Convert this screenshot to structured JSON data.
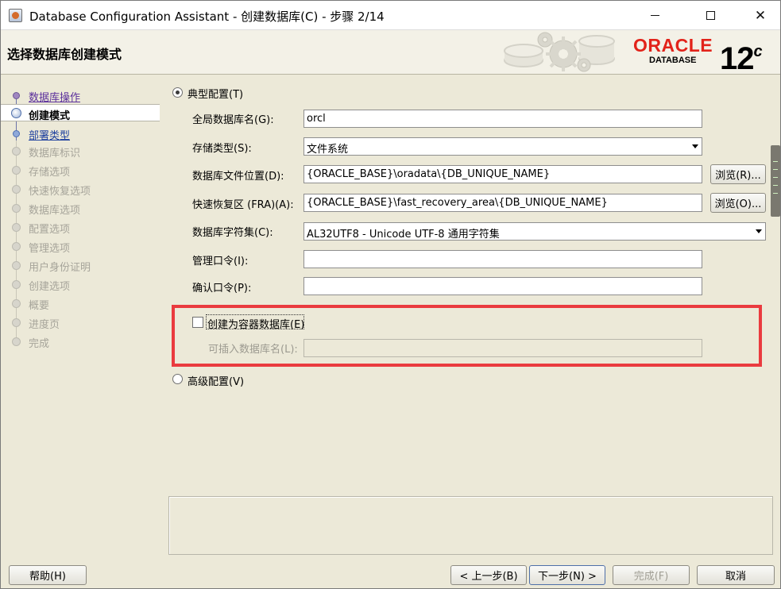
{
  "window": {
    "title": "Database Configuration Assistant - 创建数据库(C) - 步骤 2/14",
    "minimize": "—",
    "maximize": "☐",
    "close": "✕"
  },
  "banner": {
    "title": "选择数据库创建模式",
    "logo_word": "ORACLE",
    "logo_sub": "DATABASE",
    "version": "12",
    "version_sup": "c"
  },
  "nav": {
    "items": [
      {
        "label": "数据库操作",
        "state": "done"
      },
      {
        "label": "创建模式",
        "state": "current"
      },
      {
        "label": "部署类型",
        "state": "link"
      },
      {
        "label": "数据库标识",
        "state": "pending"
      },
      {
        "label": "存储选项",
        "state": "pending"
      },
      {
        "label": "快速恢复选项",
        "state": "pending"
      },
      {
        "label": "数据库选项",
        "state": "pending"
      },
      {
        "label": "配置选项",
        "state": "pending"
      },
      {
        "label": "管理选项",
        "state": "pending"
      },
      {
        "label": "用户身份证明",
        "state": "pending"
      },
      {
        "label": "创建选项",
        "state": "pending"
      },
      {
        "label": "概要",
        "state": "pending"
      },
      {
        "label": "进度页",
        "state": "pending"
      },
      {
        "label": "完成",
        "state": "pending"
      }
    ]
  },
  "form": {
    "typical_label": "典型配置(T)",
    "global_db_name_label": "全局数据库名(G):",
    "global_db_name_value": "orcl",
    "storage_type_label": "存储类型(S):",
    "storage_type_value": "文件系统",
    "db_file_location_label": "数据库文件位置(D):",
    "db_file_location_value": "{ORACLE_BASE}\\oradata\\{DB_UNIQUE_NAME}",
    "browse1_label": "浏览(R)...",
    "fra_label": "快速恢复区 (FRA)(A):",
    "fra_value": "{ORACLE_BASE}\\fast_recovery_area\\{DB_UNIQUE_NAME}",
    "browse2_label": "浏览(O)...",
    "charset_label": "数据库字符集(C):",
    "charset_value": "AL32UTF8 - Unicode UTF-8 通用字符集",
    "admin_password_label": "管理口令(I):",
    "admin_password_value": "",
    "confirm_password_label": "确认口令(P):",
    "confirm_password_value": "",
    "container_label": "创建为容器数据库(E)",
    "pluggable_label": "可插入数据库名(L):",
    "pluggable_value": "",
    "advanced_label": "高级配置(V)"
  },
  "footer": {
    "help": "帮助(H)",
    "back": "< 上一步(B)",
    "next": "下一步(N) >",
    "finish": "完成(F)",
    "cancel": "取消"
  }
}
